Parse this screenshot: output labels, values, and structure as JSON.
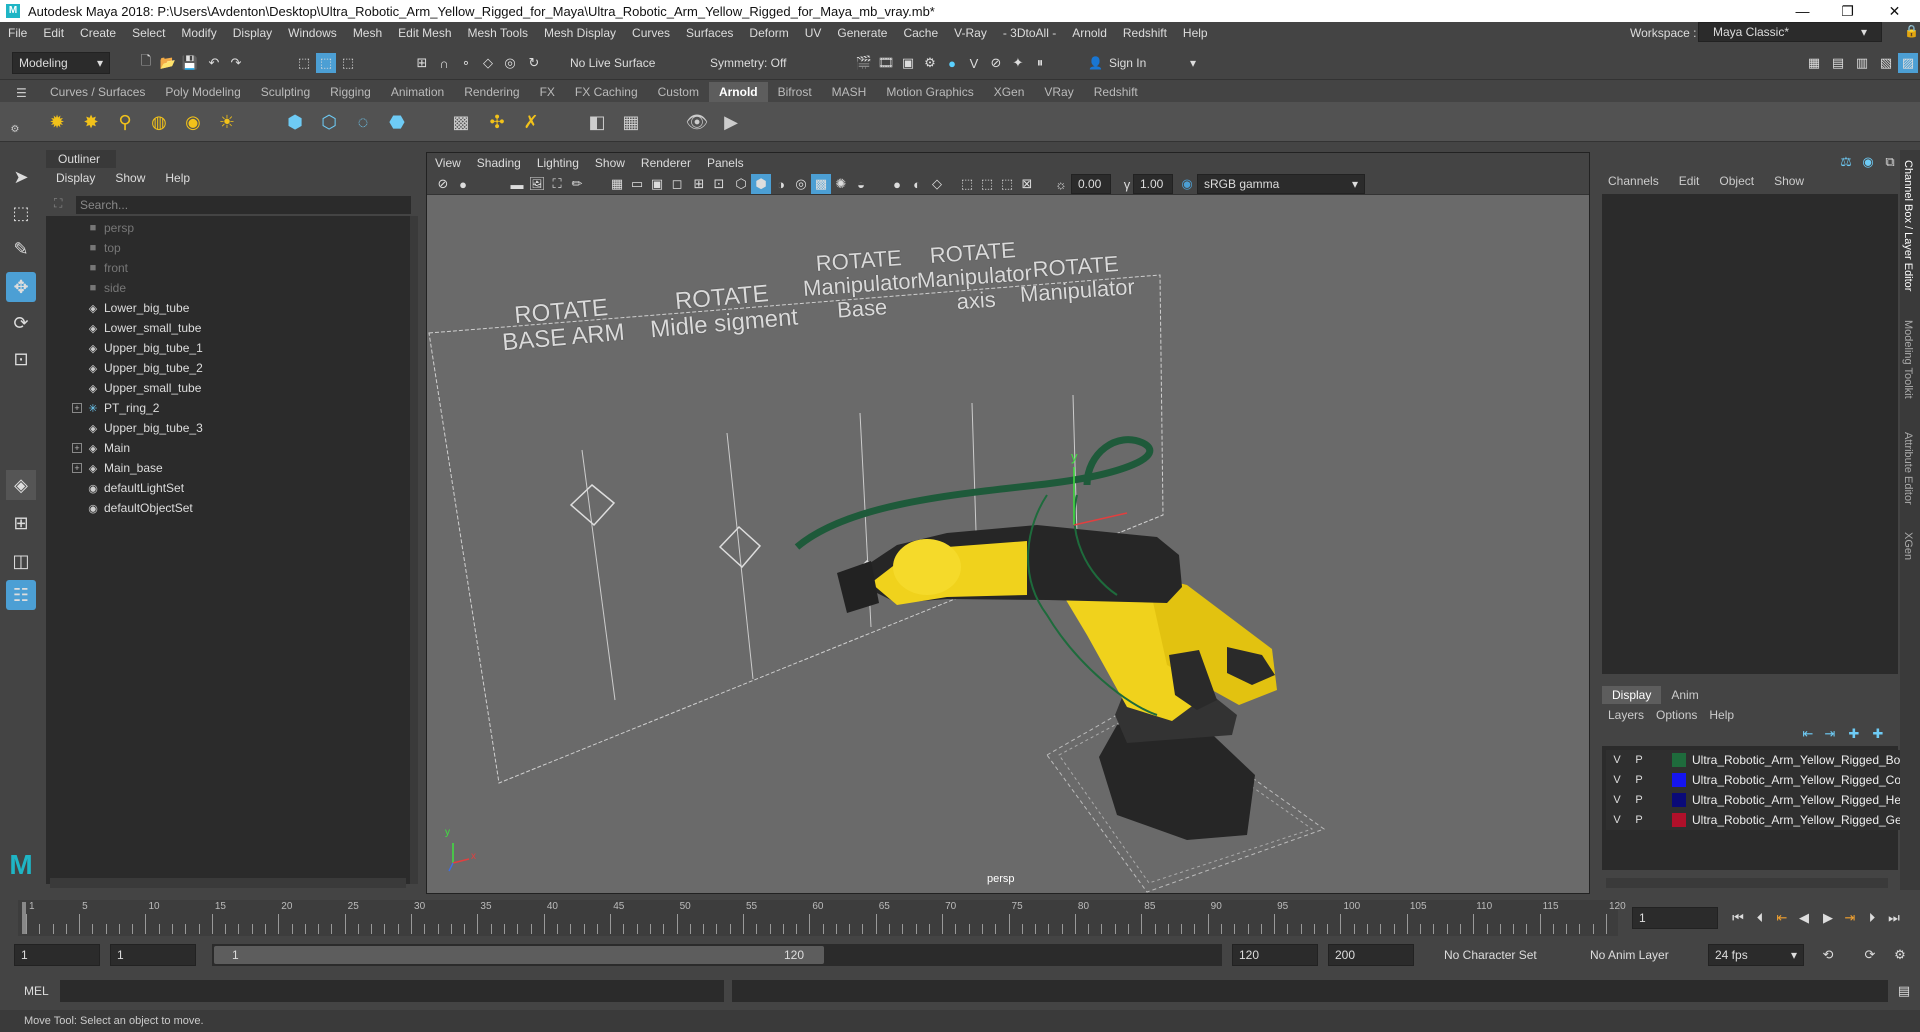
{
  "titlebar": {
    "title": "Autodesk Maya 2018: P:\\Users\\Avdenton\\Desktop\\Ultra_Robotic_Arm_Yellow_Rigged_for_Maya\\Ultra_Robotic_Arm_Yellow_Rigged_for_Maya_mb_vray.mb*",
    "minimize": "—",
    "maximize": "❐",
    "close": "✕"
  },
  "menubar": {
    "items": [
      "File",
      "Edit",
      "Create",
      "Select",
      "Modify",
      "Display",
      "Windows",
      "Mesh",
      "Edit Mesh",
      "Mesh Tools",
      "Mesh Display",
      "Curves",
      "Surfaces",
      "Deform",
      "UV",
      "Generate",
      "Cache",
      "V-Ray",
      "- 3DtoAll -",
      "Arnold",
      "Redshift",
      "Help"
    ]
  },
  "workspace": {
    "label": "Workspace :",
    "value": "Maya Classic*"
  },
  "statusline": {
    "mode": "Modeling",
    "live_surface": "No Live Surface",
    "symmetry": "Symmetry: Off",
    "sign_in": "Sign In"
  },
  "shelf": {
    "tabs": [
      "Curves / Surfaces",
      "Poly Modeling",
      "Sculpting",
      "Rigging",
      "Animation",
      "Rendering",
      "FX",
      "FX Caching",
      "Custom",
      "Arnold",
      "Bifrost",
      "MASH",
      "Motion Graphics",
      "XGen",
      "VRay",
      "Redshift"
    ],
    "active": "Arnold"
  },
  "outliner": {
    "title": "Outliner",
    "menu": [
      "Display",
      "Show",
      "Help"
    ],
    "search_placeholder": "Search...",
    "items": [
      {
        "label": "persp",
        "icon": "camera-icon",
        "dim": true,
        "expand": false
      },
      {
        "label": "top",
        "icon": "camera-icon",
        "dim": true,
        "expand": false
      },
      {
        "label": "front",
        "icon": "camera-icon",
        "dim": true,
        "expand": false
      },
      {
        "label": "side",
        "icon": "camera-icon",
        "dim": true,
        "expand": false
      },
      {
        "label": "Lower_big_tube",
        "icon": "transform-icon",
        "dim": false,
        "expand": false
      },
      {
        "label": "Lower_small_tube",
        "icon": "transform-icon",
        "dim": false,
        "expand": false
      },
      {
        "label": "Upper_big_tube_1",
        "icon": "transform-icon",
        "dim": false,
        "expand": false
      },
      {
        "label": "Upper_big_tube_2",
        "icon": "transform-icon",
        "dim": false,
        "expand": false
      },
      {
        "label": "Upper_small_tube",
        "icon": "transform-icon",
        "dim": false,
        "expand": false
      },
      {
        "label": "PT_ring_2",
        "icon": "joint-icon",
        "dim": false,
        "expand": true
      },
      {
        "label": "Upper_big_tube_3",
        "icon": "transform-icon",
        "dim": false,
        "expand": false
      },
      {
        "label": "Main",
        "icon": "transform-icon",
        "dim": false,
        "expand": true
      },
      {
        "label": "Main_base",
        "icon": "transform-icon",
        "dim": false,
        "expand": true
      },
      {
        "label": "defaultLightSet",
        "icon": "set-icon",
        "dim": false,
        "expand": false
      },
      {
        "label": "defaultObjectSet",
        "icon": "set-icon",
        "dim": false,
        "expand": false
      }
    ]
  },
  "viewport": {
    "menu": [
      "View",
      "Shading",
      "Lighting",
      "Show",
      "Renderer",
      "Panels"
    ],
    "exposure": "0.00",
    "gamma": "1.00",
    "color_space": "sRGB gamma",
    "camera_label": "persp",
    "axis_y": "y",
    "axis_x": "x",
    "board_labels": [
      {
        "l1": "ROTATE",
        "l2": "BASE ARM"
      },
      {
        "l1": "ROTATE",
        "l2": "Midle sigment"
      },
      {
        "l1": "ROTATE",
        "l2": "Manipulator",
        "l3": "Base"
      },
      {
        "l1": "ROTATE",
        "l2": "Manipulator",
        "l3": "axis"
      },
      {
        "l1": "ROTATE",
        "l2": "Manipulator"
      }
    ]
  },
  "channelbox": {
    "menu": [
      "Channels",
      "Edit",
      "Object",
      "Show"
    ],
    "layer_tabs": [
      "Display",
      "Anim"
    ],
    "layer_menu": [
      "Layers",
      "Options",
      "Help"
    ],
    "layers": [
      {
        "v": "V",
        "p": "P",
        "color": "#1e6b3c",
        "name": "Ultra_Robotic_Arm_Yellow_Rigged_Bones"
      },
      {
        "v": "V",
        "p": "P",
        "color": "#1515f0",
        "name": "Ultra_Robotic_Arm_Yellow_Rigged_Controllers"
      },
      {
        "v": "V",
        "p": "P",
        "color": "#0a0a78",
        "name": "Ultra_Robotic_Arm_Yellow_Rigged_Helpers"
      },
      {
        "v": "V",
        "p": "P",
        "color": "#b0102a",
        "name": "Ultra_Robotic_Arm_Yellow_Rigged_Geometry"
      }
    ]
  },
  "right_tabs": [
    "Channel Box / Layer Editor",
    "Modeling Toolkit",
    "Attribute Editor",
    "XGen"
  ],
  "timeline": {
    "ticks": [
      "1",
      "5",
      "10",
      "15",
      "20",
      "25",
      "30",
      "35",
      "40",
      "45",
      "50",
      "55",
      "60",
      "65",
      "70",
      "75",
      "80",
      "85",
      "90",
      "95",
      "100",
      "105",
      "110",
      "115",
      "120"
    ],
    "current_frame": "1"
  },
  "range": {
    "start": "1",
    "playback_start": "1",
    "slider_start": "1",
    "slider_end": "120",
    "playback_end": "120",
    "end": "200",
    "character_set": "No Character Set",
    "anim_layer": "No Anim Layer",
    "fps": "24 fps"
  },
  "cmdline": {
    "label": "MEL"
  },
  "helpline": {
    "text": "Move Tool: Select an object to move."
  }
}
